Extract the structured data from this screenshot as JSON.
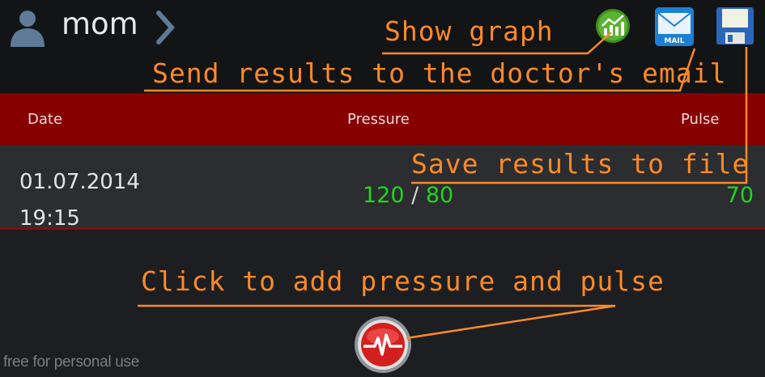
{
  "profile": {
    "name": "mom",
    "icon": "user-icon",
    "switch_icon": "chevron-right-icon"
  },
  "toolbar": {
    "graph_icon": "graph-icon",
    "mail_icon": "mail-icon",
    "mail_text": "MAIL",
    "save_icon": "floppy-disk-icon"
  },
  "table": {
    "columns": [
      "Date",
      "Pressure",
      "Pulse"
    ],
    "rows": [
      {
        "date": "01.07.2014",
        "time": "19:15",
        "systolic": "120",
        "separator": "/",
        "diastolic": "80",
        "pulse": "70"
      }
    ]
  },
  "hints": {
    "graph": "Show graph",
    "email": "Send results to the doctor's email",
    "save": "Save results to file",
    "add": "Click to add pressure and pulse"
  },
  "add_button": {
    "icon": "heartbeat-icon"
  },
  "footer": "free for personal use",
  "colors": {
    "header": "#870000",
    "annotation": "#ff8a26",
    "value_green": "#1fd61f",
    "actionbar": "#121416"
  }
}
